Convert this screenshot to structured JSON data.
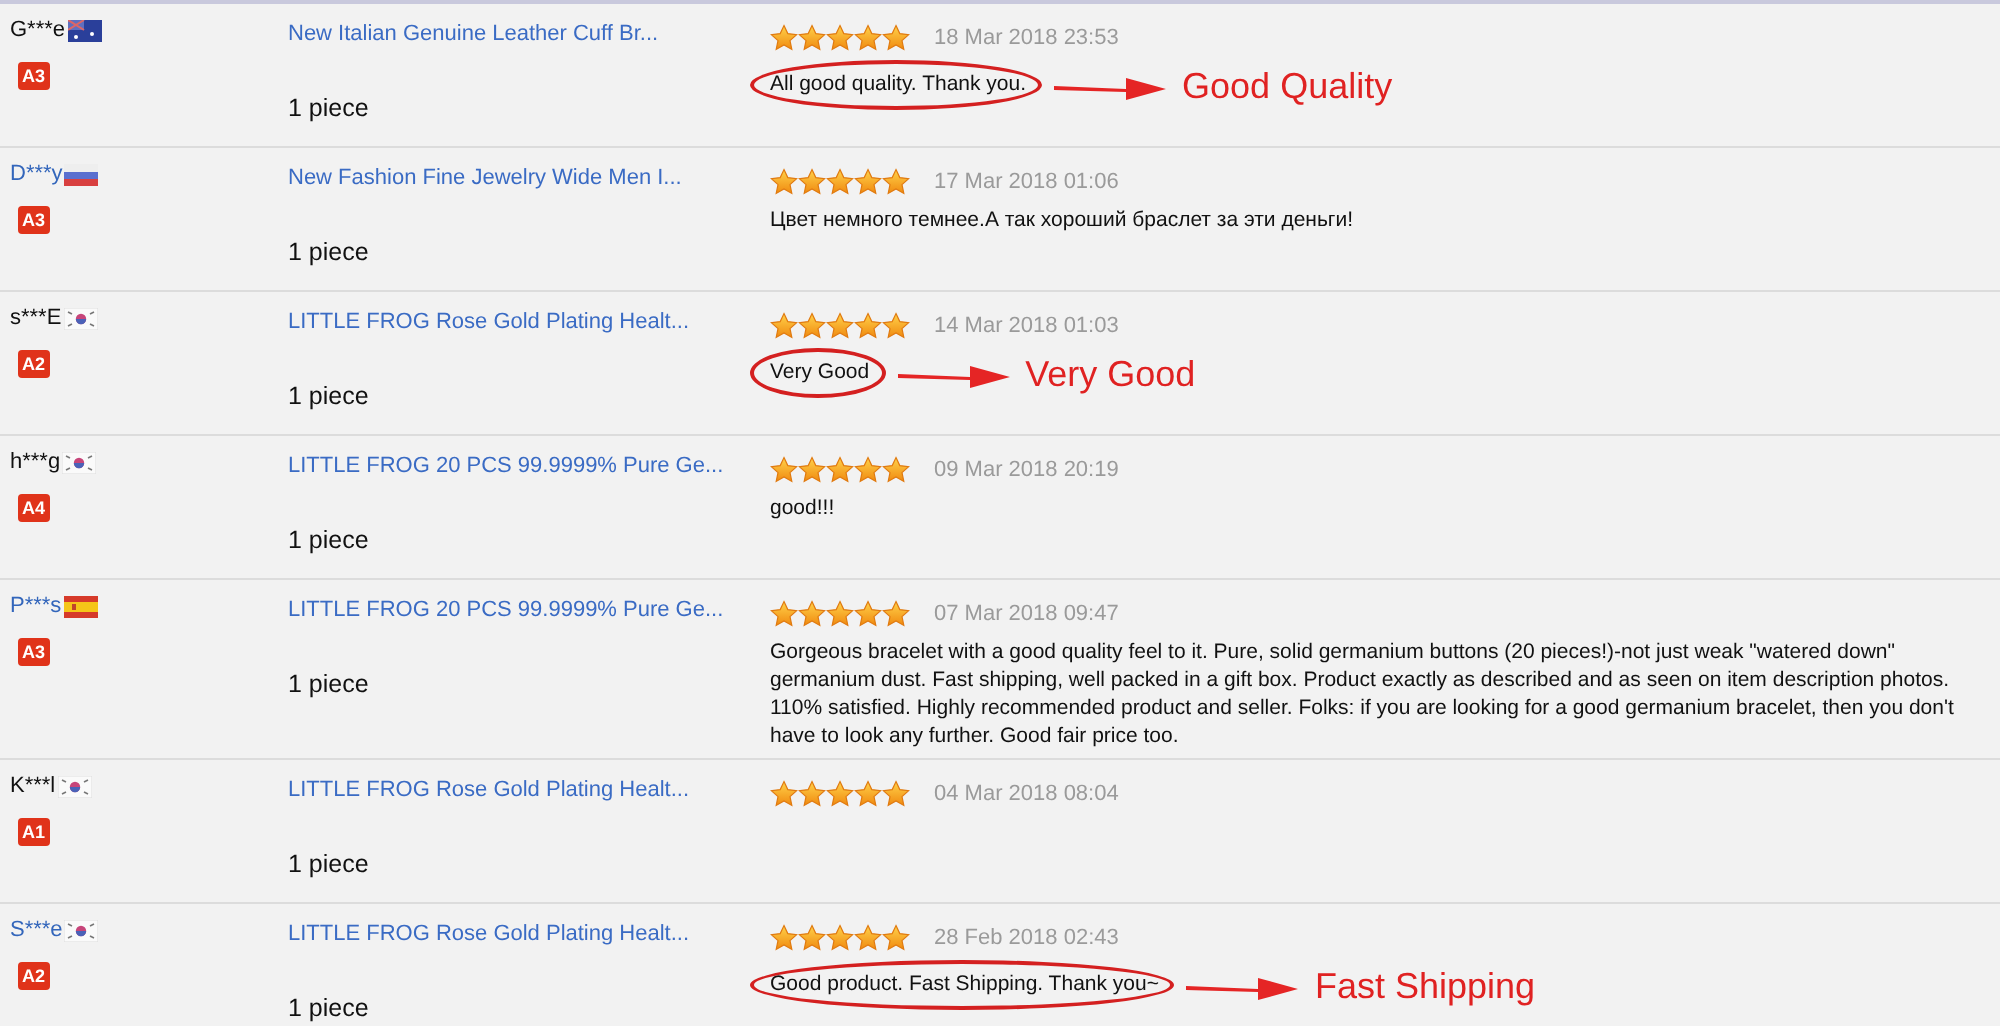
{
  "reviews": [
    {
      "buyer": "G***e",
      "buyer_link": false,
      "flag": {
        "kind": "au"
      },
      "level_badge": "A3",
      "product": "New Italian Genuine Leather Cuff Br...",
      "quantity": "1 piece",
      "stars": 5,
      "date": "18 Mar 2018 23:53",
      "comment": "All good quality. Thank you.",
      "circled": true,
      "annotation": "Good Quality"
    },
    {
      "buyer": "D***y",
      "buyer_link": true,
      "flag": {
        "kind": "ru"
      },
      "level_badge": "A3",
      "product": "New Fashion Fine Jewelry Wide Men I...",
      "quantity": "1 piece",
      "stars": 5,
      "date": "17 Mar 2018 01:06",
      "comment": "Цвет немного темнее.А так хороший браслет за эти деньги!",
      "circled": false
    },
    {
      "buyer": "s***E",
      "buyer_link": false,
      "flag": {
        "kind": "kr"
      },
      "level_badge": "A2",
      "product": "LITTLE FROG Rose Gold Plating Healt...",
      "quantity": "1 piece",
      "stars": 5,
      "date": "14 Mar 2018 01:03",
      "comment": "Very Good",
      "circled": true,
      "annotation": "Very Good"
    },
    {
      "buyer": "h***g",
      "buyer_link": false,
      "flag": {
        "kind": "kr"
      },
      "level_badge": "A4",
      "product": "LITTLE FROG 20 PCS 99.9999% Pure Ge...",
      "quantity": "1 piece",
      "stars": 5,
      "date": "09 Mar 2018 20:19",
      "comment": "good!!!",
      "circled": false
    },
    {
      "buyer": "P***s",
      "buyer_link": true,
      "flag": {
        "kind": "es"
      },
      "level_badge": "A3",
      "product": "LITTLE FROG 20 PCS 99.9999% Pure Ge...",
      "quantity": "1 piece",
      "stars": 5,
      "date": "07 Mar 2018 09:47",
      "comment": "Gorgeous bracelet with a good quality feel to it. Pure, solid germanium buttons (20 pieces!)-not just weak \"watered down\" germanium dust. Fast shipping, well packed in a gift box. Product exactly as described and as seen on item description photos. 110% satisfied. Highly recommended product and seller. Folks: if you are looking for a good germanium bracelet, then you don't have to look any further. Good fair price too.",
      "circled": false
    },
    {
      "buyer": "K***l",
      "buyer_link": false,
      "flag": {
        "kind": "kr"
      },
      "level_badge": "A1",
      "product": "LITTLE FROG Rose Gold Plating Healt...",
      "quantity": "1 piece",
      "stars": 5,
      "date": "04 Mar 2018 08:04",
      "circled": false
    },
    {
      "buyer": "S***e",
      "buyer_link": true,
      "flag": {
        "kind": "kr"
      },
      "level_badge": "A2",
      "product": "LITTLE FROG Rose Gold Plating Healt...",
      "quantity": "1 piece",
      "stars": 5,
      "date": "28 Feb 2018 02:43",
      "comment": "Good product. Fast Shipping. Thank you~",
      "circled": true,
      "annotation": "Fast Shipping"
    }
  ]
}
